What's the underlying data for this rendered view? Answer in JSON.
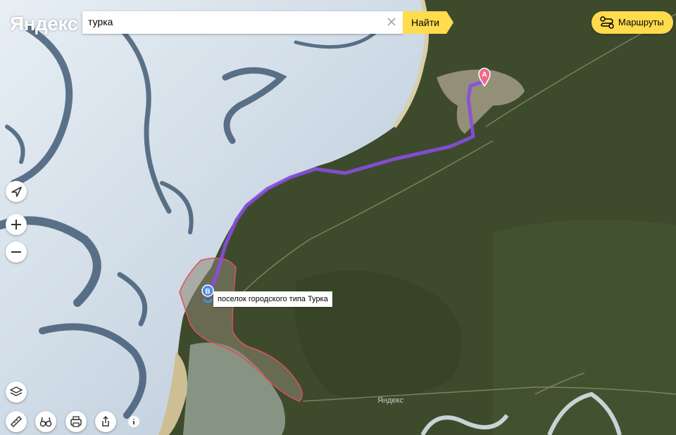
{
  "brand": {
    "logo": "Яндекс",
    "watermark": "Яндекс"
  },
  "search": {
    "value": "турка",
    "button_label": "Найти"
  },
  "routes_button": {
    "label": "Маршруты"
  },
  "markers": {
    "a_letter": "A",
    "b_letter": "B"
  },
  "place_label": "поселок городского типа Турка",
  "controls": {
    "left_icons": [
      "location-arrow-icon",
      "zoom-in-icon",
      "zoom-out-icon",
      "layers-icon"
    ],
    "bottom_icons": [
      "ruler-icon",
      "binoculars-icon",
      "print-icon",
      "share-icon",
      "info-icon"
    ]
  },
  "colors": {
    "route": "#8a4ce0",
    "accent": "#ffdb4d",
    "settlement_border": "#e0505a",
    "marker_a": "#f06a8a",
    "marker_b": "#4a8cf0"
  }
}
